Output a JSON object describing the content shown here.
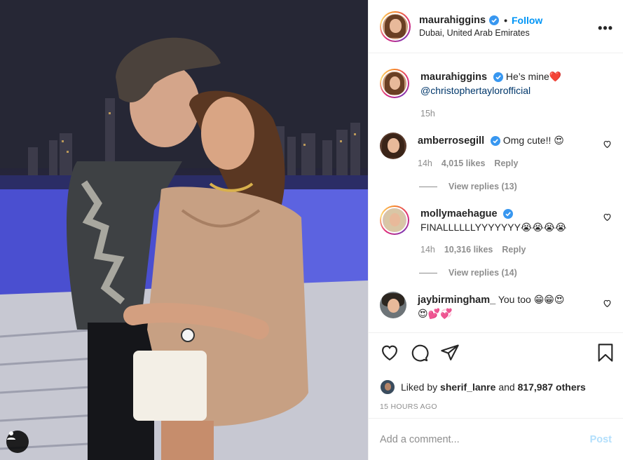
{
  "post": {
    "author": "maurahiggins",
    "follow_label": "Follow",
    "location": "Dubai, United Arab Emirates",
    "caption_text": "He’s mine❤️",
    "caption_mention": "@christophertaylorofficial",
    "caption_time": "15h"
  },
  "comments": [
    {
      "user": "amberrosegill",
      "verified": true,
      "text": "Omg cute!! 😍",
      "time": "14h",
      "likes": "4,015 likes",
      "reply": "Reply",
      "view_replies": "View replies (13)"
    },
    {
      "user": "mollymaehague",
      "verified": true,
      "text": "FINALLLLLLYYYYYYY😭😭😭😭",
      "time": "14h",
      "likes": "10,316 likes",
      "reply": "Reply",
      "view_replies": "View replies (14)"
    },
    {
      "user": "jaybirmingham_",
      "verified": false,
      "text": "You too 😁😁😍",
      "text2": "😍💕💞"
    }
  ],
  "likes": {
    "prefix": "Liked by",
    "user": "sherif_lanre",
    "and": "and",
    "others": "817,987 others"
  },
  "time_ago": "15 HOURS AGO",
  "add_comment": {
    "placeholder": "Add a comment...",
    "post_label": "Post"
  },
  "icons": [
    "heart-icon",
    "comment-icon",
    "share-icon",
    "bookmark-icon",
    "more-icon",
    "verified-icon",
    "user-tag-icon"
  ],
  "colors": {
    "accent": "#0095f6",
    "post_disabled": "#b2dffc",
    "mention": "#00376b",
    "muted": "#8e8e8e"
  }
}
